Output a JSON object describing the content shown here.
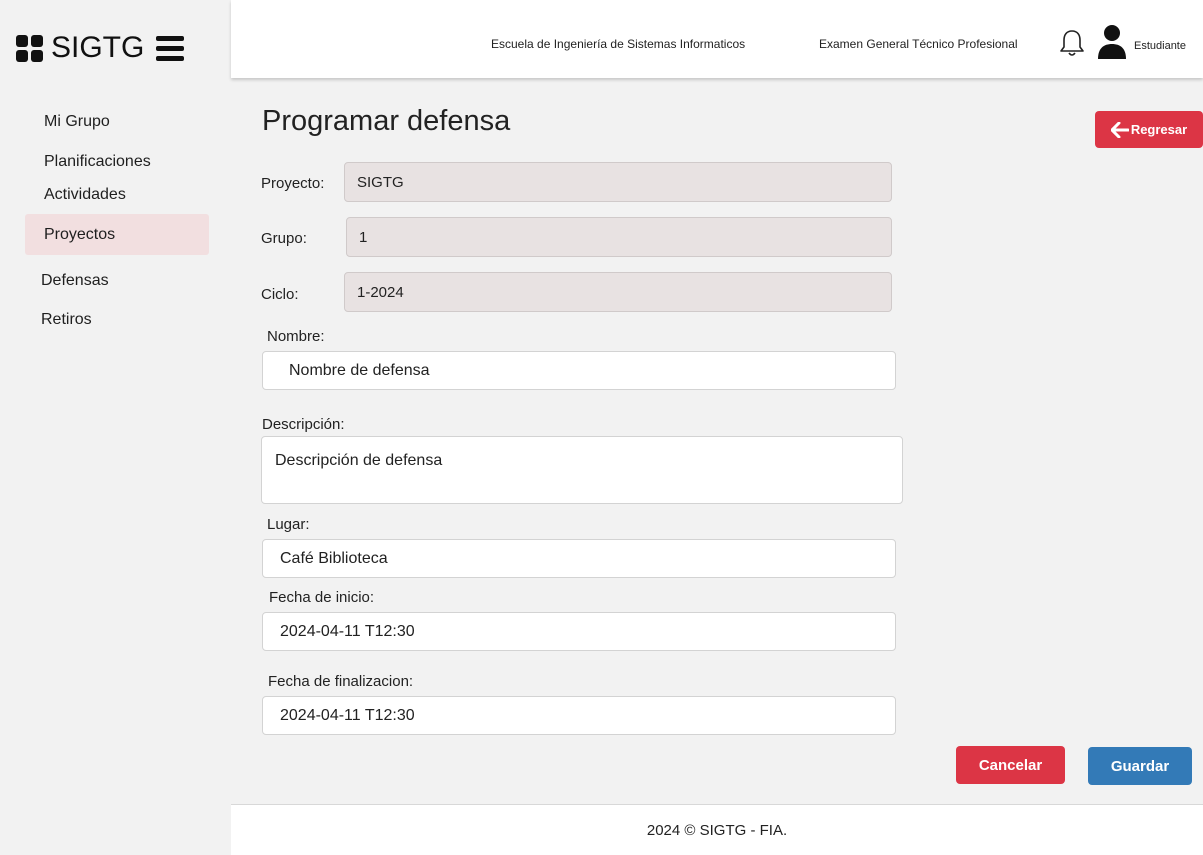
{
  "app": {
    "name": "SIGTG"
  },
  "header": {
    "school": "Escuela de Ingeniería de Sistemas Informaticos",
    "exam": "Examen General Técnico Profesional",
    "user_role": "Estudiante"
  },
  "sidebar": {
    "items": [
      {
        "label": "Mi Grupo"
      },
      {
        "label": "Planificaciones"
      },
      {
        "label": "Actividades"
      },
      {
        "label": "Proyectos",
        "active": true
      },
      {
        "label": "Defensas"
      },
      {
        "label": "Retiros"
      }
    ]
  },
  "page": {
    "title": "Programar defensa",
    "back_label": "Regresar"
  },
  "form": {
    "proyecto": {
      "label": "Proyecto:",
      "value": "SIGTG"
    },
    "grupo": {
      "label": "Grupo:",
      "value": "1"
    },
    "ciclo": {
      "label": "Ciclo:",
      "value": "1-2024"
    },
    "nombre": {
      "label": "Nombre:",
      "value": "Nombre de defensa"
    },
    "descripcion": {
      "label": "Descripción:",
      "value": "Descripción de defensa"
    },
    "lugar": {
      "label": "Lugar:",
      "value": "Café Biblioteca"
    },
    "fecha_inicio": {
      "label": "Fecha de inicio:",
      "value": "2024-04-11 T12:30"
    },
    "fecha_fin": {
      "label": "Fecha de finalizacion:",
      "value": "2024-04-11 T12:30"
    }
  },
  "actions": {
    "cancel_label": "Cancelar",
    "save_label": "Guardar"
  },
  "footer": {
    "text": "2024 © SIGTG - FIA."
  },
  "colors": {
    "danger": "#dc3545",
    "primary": "#337ab7",
    "active_nav": "#f2dfe0",
    "readonly_field": "#e8e2e2"
  },
  "icons": {
    "brand": "grid-icon",
    "menu": "hamburger-icon",
    "bell": "bell-icon",
    "user": "user-icon",
    "back": "arrow-left-icon"
  }
}
